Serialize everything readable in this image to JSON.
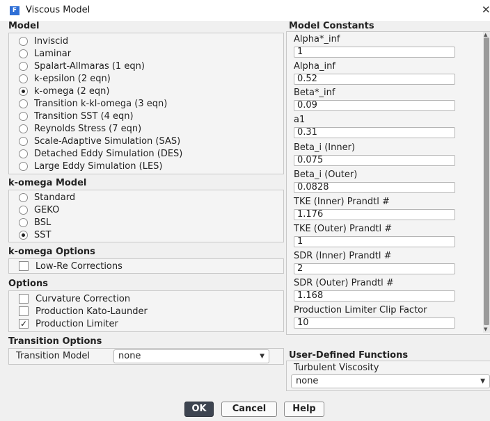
{
  "window": {
    "title": "Viscous Model",
    "icon_label": "F",
    "close_label": "✕"
  },
  "model": {
    "title": "Model",
    "options": [
      {
        "label": "Inviscid",
        "selected": false
      },
      {
        "label": "Laminar",
        "selected": false
      },
      {
        "label": "Spalart-Allmaras (1 eqn)",
        "selected": false
      },
      {
        "label": "k-epsilon (2 eqn)",
        "selected": false
      },
      {
        "label": "k-omega (2 eqn)",
        "selected": true
      },
      {
        "label": "Transition k-kl-omega (3 eqn)",
        "selected": false
      },
      {
        "label": "Transition SST (4 eqn)",
        "selected": false
      },
      {
        "label": "Reynolds Stress (7 eqn)",
        "selected": false
      },
      {
        "label": "Scale-Adaptive Simulation (SAS)",
        "selected": false
      },
      {
        "label": "Detached Eddy Simulation (DES)",
        "selected": false
      },
      {
        "label": "Large Eddy Simulation (LES)",
        "selected": false
      }
    ]
  },
  "kw_model": {
    "title": "k-omega Model",
    "options": [
      {
        "label": "Standard",
        "selected": false
      },
      {
        "label": "GEKO",
        "selected": false
      },
      {
        "label": "BSL",
        "selected": false
      },
      {
        "label": "SST",
        "selected": true
      }
    ]
  },
  "kw_options": {
    "title": "k-omega Options",
    "items": [
      {
        "label": "Low-Re Corrections",
        "checked": false
      }
    ]
  },
  "options": {
    "title": "Options",
    "items": [
      {
        "label": "Curvature Correction",
        "checked": false
      },
      {
        "label": "Production Kato-Launder",
        "checked": false
      },
      {
        "label": "Production Limiter",
        "checked": true
      }
    ]
  },
  "transition": {
    "title": "Transition Options",
    "label": "Transition Model",
    "value": "none"
  },
  "constants": {
    "title": "Model Constants",
    "items": [
      {
        "label": "Alpha*_inf",
        "value": "1"
      },
      {
        "label": "Alpha_inf",
        "value": "0.52"
      },
      {
        "label": "Beta*_inf",
        "value": "0.09"
      },
      {
        "label": "a1",
        "value": "0.31"
      },
      {
        "label": "Beta_i (Inner)",
        "value": "0.075"
      },
      {
        "label": "Beta_i (Outer)",
        "value": "0.0828"
      },
      {
        "label": "TKE (Inner) Prandtl #",
        "value": "1.176"
      },
      {
        "label": "TKE (Outer) Prandtl #",
        "value": "1"
      },
      {
        "label": "SDR (Inner) Prandtl #",
        "value": "2"
      },
      {
        "label": "SDR (Outer) Prandtl #",
        "value": "1.168"
      },
      {
        "label": "Production Limiter Clip Factor",
        "value": "10"
      }
    ]
  },
  "udf": {
    "title": "User-Defined Functions",
    "label": "Turbulent Viscosity",
    "value": "none"
  },
  "buttons": {
    "ok": "OK",
    "cancel": "Cancel",
    "help": "Help"
  }
}
